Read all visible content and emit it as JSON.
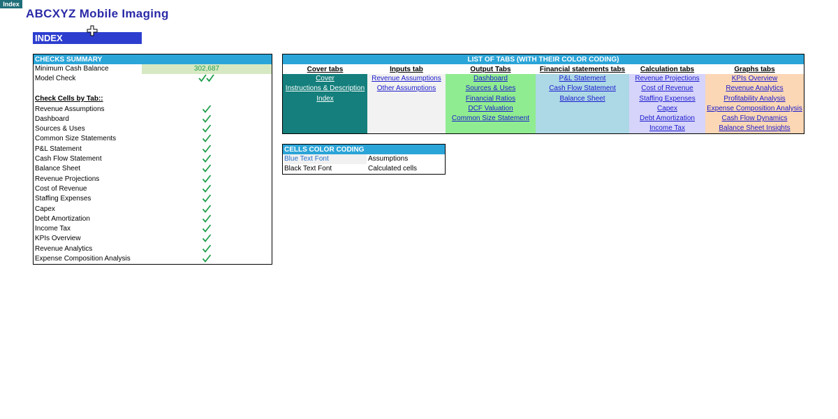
{
  "sheet_tab": "Index",
  "company_title": "ABCXYZ Mobile Imaging",
  "index_heading": "INDEX",
  "checks": {
    "header": "CHECKS SUMMARY",
    "min_cash_label": "Minimum Cash Balance",
    "min_cash_value": "302,687",
    "model_check_label": "Model Check",
    "by_tab_heading": "Check Cells by Tab::",
    "items": [
      "Revenue Assumptions",
      "Dashboard",
      "Sources & Uses",
      "Common Size Statements",
      "P&L Statement",
      "Cash Flow Statement",
      "Balance Sheet",
      "Revenue Projections",
      "Cost of Revenue",
      "Staffing Expenses",
      "Capex",
      "Debt Amortization",
      "Income Tax",
      "KPIs Overview",
      "Revenue Analytics",
      "Expense Composition Analysis"
    ],
    "check_color": "#1f9e4a"
  },
  "tabs_list": {
    "header": "LIST OF TABS (WITH THEIR COLOR CODING)",
    "columns": [
      {
        "title": "Cover tabs",
        "color": "#147f7c",
        "light": true,
        "links": [
          "Cover",
          "Instructions & Description",
          "Index"
        ]
      },
      {
        "title": "Inputs tab",
        "color": "#f2f2f2",
        "light": false,
        "links": [
          "Revenue Assumptions",
          "Other Assumptions"
        ]
      },
      {
        "title": "Output Tabs",
        "color": "#90ec90",
        "light": false,
        "links": [
          "Dashboard",
          "Sources & Uses",
          "Financial Ratios",
          "DCF Valuation",
          "Common Size Statement"
        ]
      },
      {
        "title": "Financial statements tabs",
        "color": "#add8e6",
        "light": false,
        "links": [
          "P&L Statement",
          "Cash Flow Statement",
          "Balance Sheet"
        ]
      },
      {
        "title": "Calculation tabs",
        "color": "#d6d4fa",
        "light": false,
        "links": [
          "Revenue Projections",
          "Cost of Revenue",
          "Staffing Expenses",
          "Capex",
          "Debt Amortization",
          "Income Tax"
        ]
      },
      {
        "title": "Graphs tabs",
        "color": "#fbd7b6",
        "light": false,
        "links": [
          "KPIs Overview",
          "Revenue Analytics",
          "Profitability Analysis",
          "Expense Composition Analysis",
          "Cash Flow Dynamics",
          "Balance Sheet Insights"
        ]
      }
    ]
  },
  "color_coding": {
    "header": "CELLS COLOR CODING",
    "rows": [
      {
        "key": "Blue Text Font",
        "value": "Assumptions"
      },
      {
        "key": "Black Text Font",
        "value": "Calculated cells"
      }
    ]
  }
}
